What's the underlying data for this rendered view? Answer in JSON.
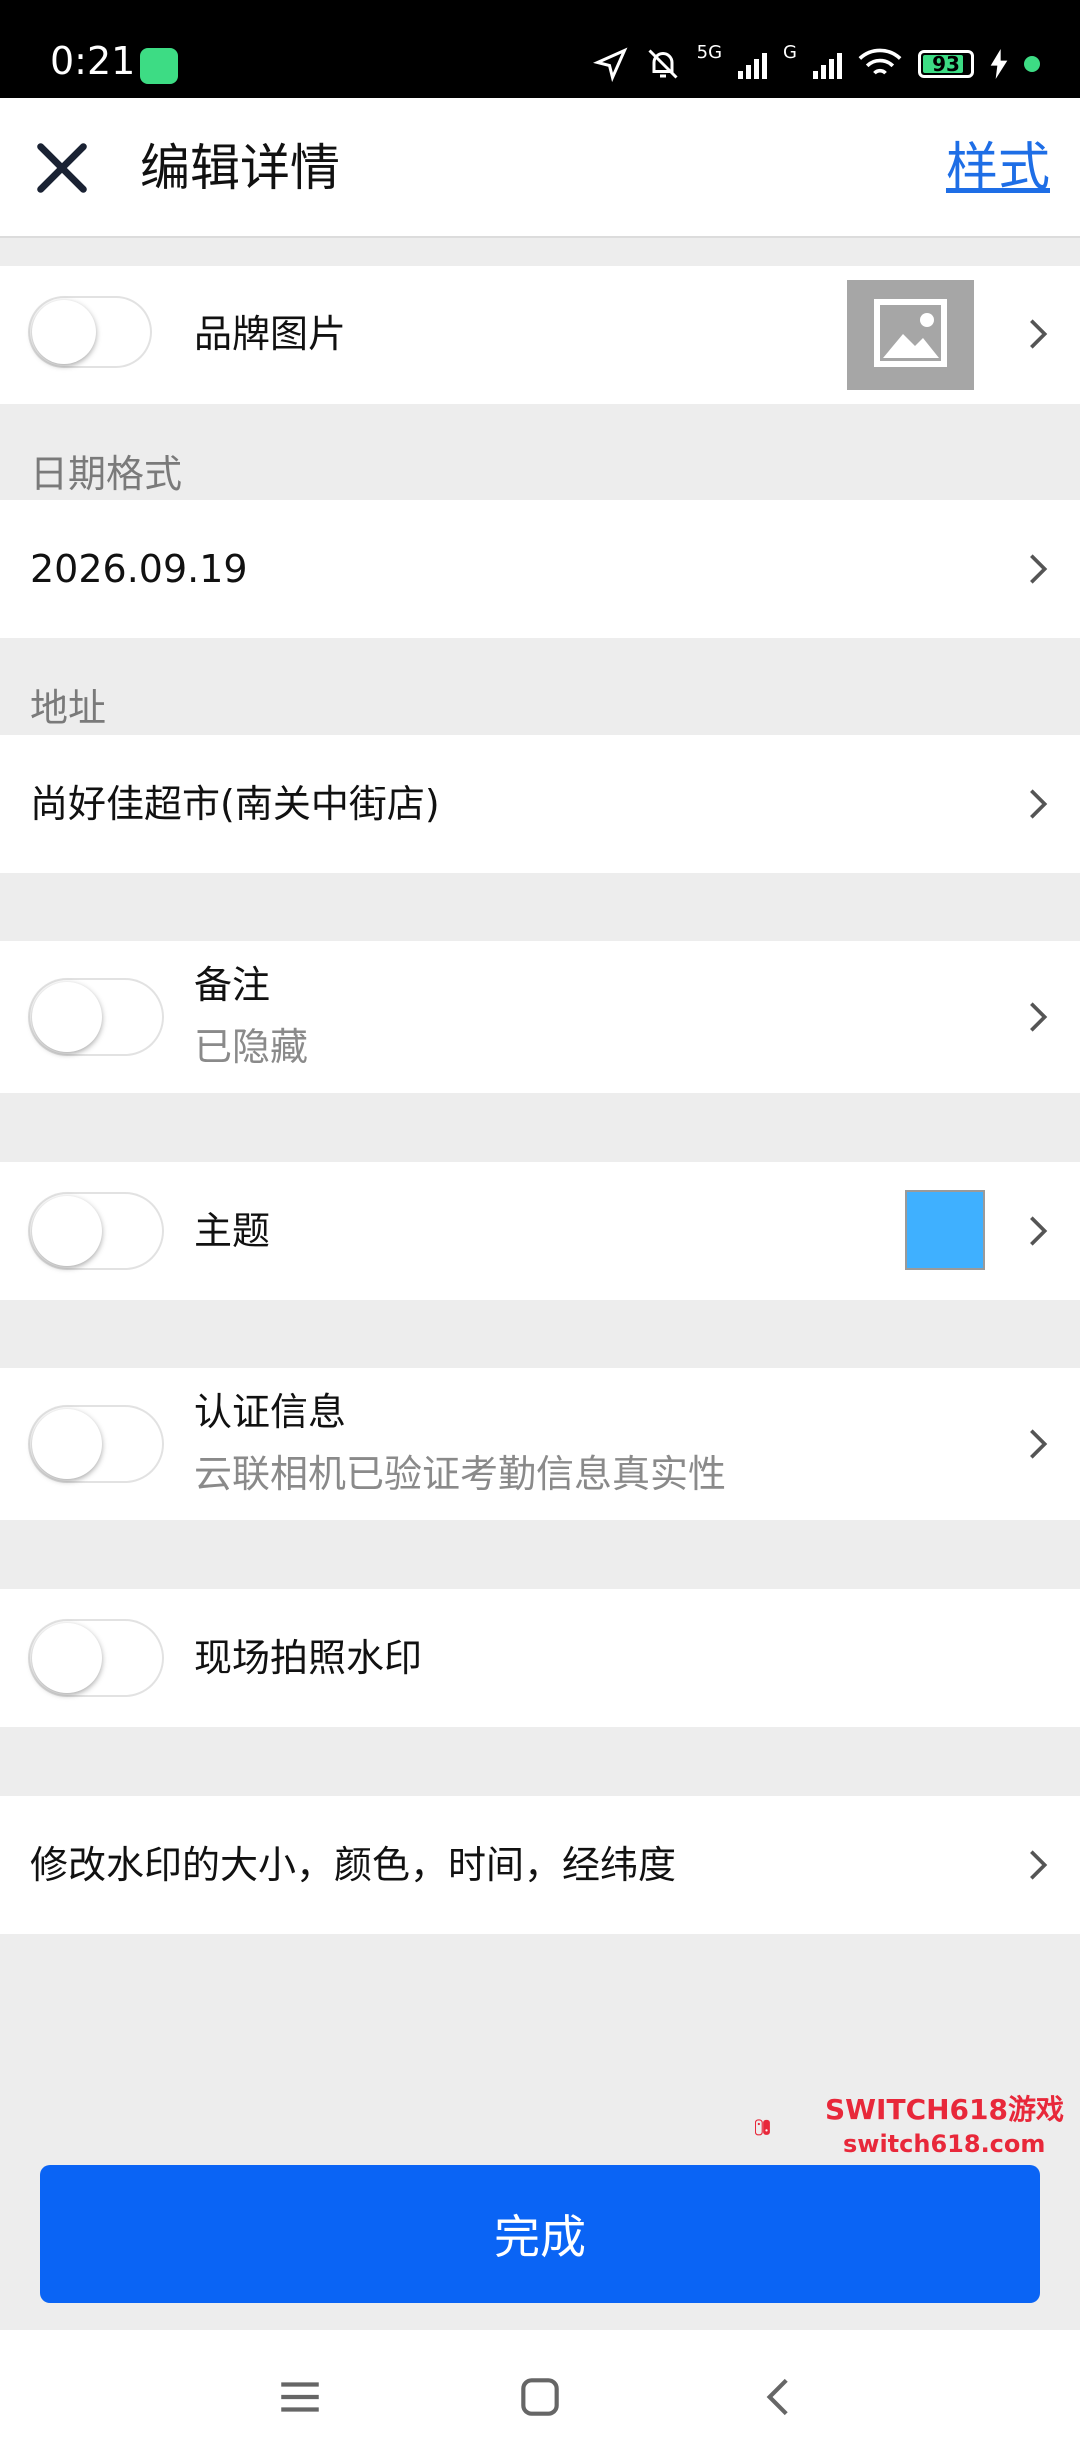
{
  "status_bar": {
    "time": "0:21",
    "network_label": "5G",
    "network_label_2": "G",
    "battery_percent": "93",
    "icons": [
      "android-icon",
      "location-icon",
      "bell-mute-icon",
      "signal-5g-icon",
      "signal-g-icon",
      "wifi-icon",
      "battery-icon",
      "charging-icon"
    ]
  },
  "app_bar": {
    "title": "编辑详情",
    "style_link": "样式",
    "close_icon": "close-icon"
  },
  "rows": {
    "brand_image": {
      "label": "品牌图片",
      "toggle_on": false
    },
    "date_section_label": "日期格式",
    "date_value": "2026.09.19",
    "address_section_label": "地址",
    "address_value": "尚好佳超市(南关中街店)",
    "note": {
      "label": "备注",
      "sub": "已隐藏",
      "toggle_on": false
    },
    "theme": {
      "label": "主题",
      "toggle_on": false,
      "swatch_color": "#3fb0ff"
    },
    "auth": {
      "label": "认证信息",
      "sub": "云联相机已验证考勤信息真实性",
      "toggle_on": false
    },
    "onsite": {
      "label": "现场拍照水印",
      "toggle_on": false
    },
    "modify": {
      "label": "修改水印的大小，颜色，时间，经纬度"
    }
  },
  "watermark": {
    "line1": "SWITCH618游戏",
    "line2": "switch618.com"
  },
  "done_button": "完成",
  "colors": {
    "accent": "#0a64f5",
    "link": "#1e6ee6",
    "background": "#ededed"
  }
}
